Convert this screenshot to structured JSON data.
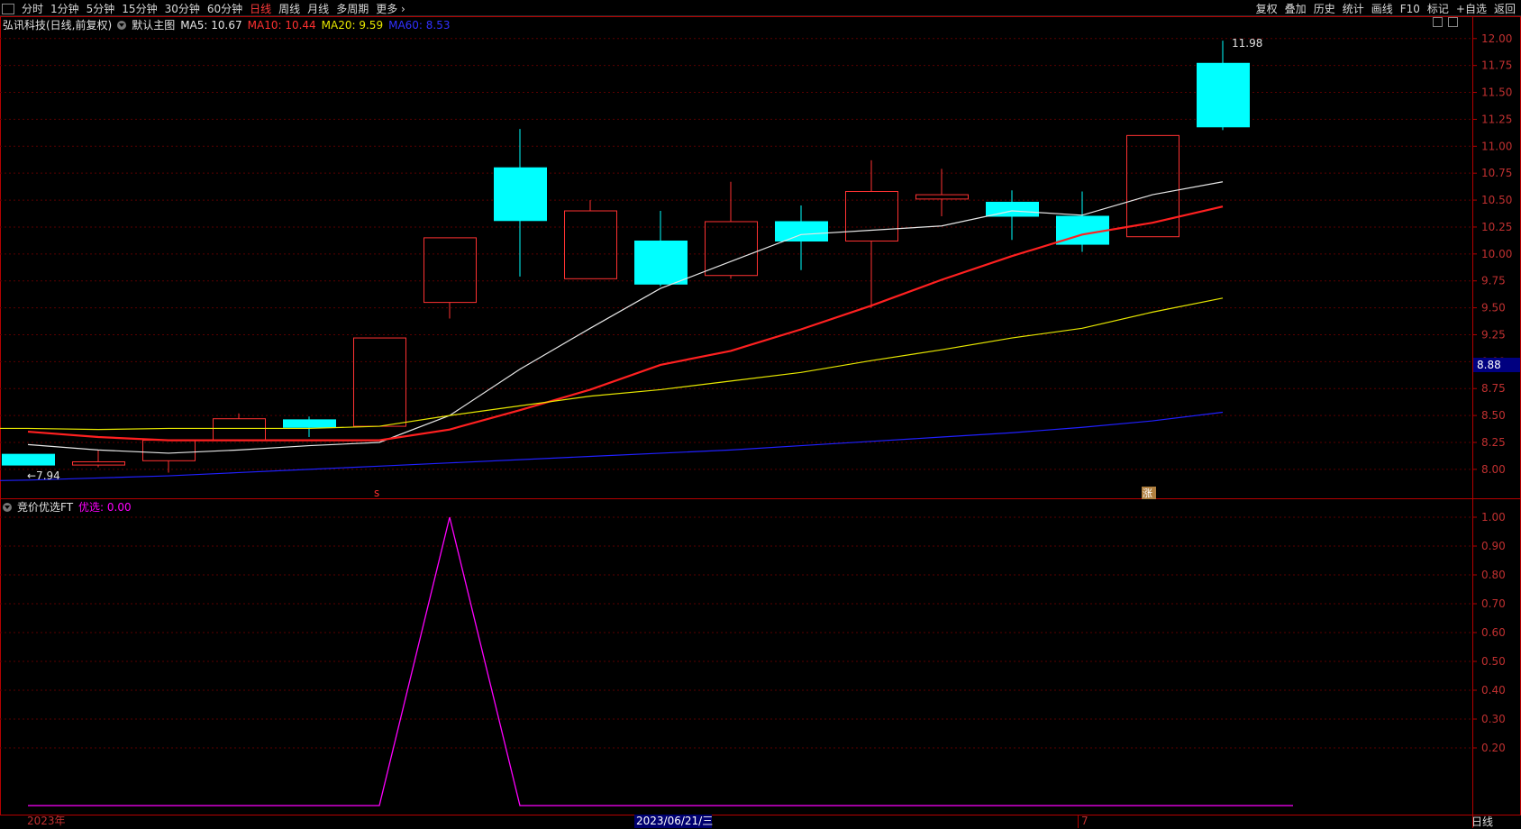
{
  "toolbar": {
    "left_items": [
      "分时",
      "1分钟",
      "5分钟",
      "15分钟",
      "30分钟",
      "60分钟",
      "日线",
      "周线",
      "月线",
      "多周期",
      "更多 ›"
    ],
    "active_item": "日线",
    "right_items": [
      "复权",
      "叠加",
      "历史",
      "统计",
      "画线",
      "F10",
      "标记",
      "+自选",
      "返回"
    ]
  },
  "legend_main": {
    "stock": "弘讯科技(日线,前复权)",
    "template": "默认主图",
    "ma5_label": "MA5: 10.67",
    "ma10_label": "MA10: 10.44",
    "ma20_label": "MA20: 9.59",
    "ma60_label": "MA60: 8.53"
  },
  "legend_sub": {
    "indicator": "竞价优选FT",
    "value_label": "优选: 0.00"
  },
  "colors": {
    "up": "#ff3232",
    "down": "#00ffff",
    "ma5": "#e6e6e6",
    "ma10": "#ff2020",
    "ma20": "#e6e600",
    "ma60": "#2020ff",
    "ft": "#ff00ff",
    "axis": "#b40000",
    "grid": "#5a0000"
  },
  "chart_data": [
    {
      "type": "candlestick",
      "ylim": [
        7.84,
        12.04
      ],
      "y_ticks": [
        8.0,
        8.25,
        8.5,
        8.75,
        9.0,
        9.25,
        9.5,
        9.75,
        10.0,
        10.25,
        10.5,
        10.75,
        11.0,
        11.25,
        11.5,
        11.75,
        12.0
      ],
      "candles": [
        {
          "open": 8.14,
          "high": 8.14,
          "low": 8.04,
          "close": 8.04
        },
        {
          "open": 8.04,
          "high": 8.18,
          "low": 8.02,
          "close": 8.07
        },
        {
          "open": 8.08,
          "high": 8.27,
          "low": 7.97,
          "close": 8.27
        },
        {
          "open": 8.27,
          "high": 8.52,
          "low": 8.26,
          "close": 8.47
        },
        {
          "open": 8.46,
          "high": 8.49,
          "low": 8.3,
          "close": 8.39
        },
        {
          "open": 8.4,
          "high": 9.22,
          "low": 8.4,
          "close": 9.22
        },
        {
          "open": 9.55,
          "high": 10.15,
          "low": 9.4,
          "close": 10.15
        },
        {
          "open": 10.8,
          "high": 11.16,
          "low": 9.79,
          "close": 10.31
        },
        {
          "open": 9.77,
          "high": 10.5,
          "low": 9.77,
          "close": 10.4
        },
        {
          "open": 10.12,
          "high": 10.4,
          "low": 9.7,
          "close": 9.72
        },
        {
          "open": 9.8,
          "high": 10.67,
          "low": 9.77,
          "close": 10.3
        },
        {
          "open": 10.3,
          "high": 10.45,
          "low": 9.85,
          "close": 10.12
        },
        {
          "open": 10.12,
          "high": 10.87,
          "low": 9.5,
          "close": 10.58
        },
        {
          "open": 10.51,
          "high": 10.79,
          "low": 10.35,
          "close": 10.55
        },
        {
          "open": 10.48,
          "high": 10.59,
          "low": 10.13,
          "close": 10.35
        },
        {
          "open": 10.35,
          "high": 10.58,
          "low": 10.02,
          "close": 10.09
        },
        {
          "open": 10.16,
          "high": 11.1,
          "low": 10.16,
          "close": 11.1
        },
        {
          "open": 11.77,
          "high": 11.98,
          "low": 11.15,
          "close": 11.18
        }
      ],
      "series": [
        {
          "name": "MA5",
          "values": [
            8.23,
            8.18,
            8.15,
            8.18,
            8.22,
            8.25,
            8.5,
            8.93,
            9.31,
            9.68,
            9.93,
            10.18,
            10.22,
            10.26,
            10.4,
            10.36,
            10.55,
            10.67
          ]
        },
        {
          "name": "MA10",
          "values": [
            8.35,
            8.3,
            8.27,
            8.27,
            8.27,
            8.27,
            8.37,
            8.55,
            8.74,
            8.97,
            9.1,
            9.3,
            9.52,
            9.76,
            9.98,
            10.18,
            10.29,
            10.44
          ]
        },
        {
          "name": "MA20",
          "values": [
            8.38,
            8.38,
            8.37,
            8.38,
            8.38,
            8.38,
            8.4,
            8.5,
            8.59,
            8.68,
            8.74,
            8.82,
            8.9,
            9.01,
            9.11,
            9.22,
            9.31,
            9.46,
            9.59
          ]
        },
        {
          "name": "MA60",
          "values": [
            7.89,
            7.9,
            7.92,
            7.94,
            7.97,
            8.0,
            8.03,
            8.06,
            8.09,
            8.12,
            8.15,
            8.18,
            8.22,
            8.26,
            8.3,
            8.34,
            8.39,
            8.45,
            8.53
          ]
        }
      ],
      "annotations": {
        "high_label": "11.98",
        "low_label": "←7.94",
        "right_price": "8.88",
        "marker_s": "s",
        "marker_2": "涨"
      }
    },
    {
      "type": "line",
      "ylim": [
        0,
        1.0
      ],
      "y_ticks": [
        "1.00",
        "0.90",
        "0.80",
        "0.70",
        "0.60",
        "0.50",
        "0.40",
        "0.30",
        "0.20"
      ],
      "series": [
        {
          "name": "优选",
          "values": [
            0,
            0,
            0,
            0,
            0,
            0,
            1,
            0,
            0,
            0,
            0,
            0,
            0,
            0,
            0,
            0,
            0,
            0,
            0
          ]
        }
      ]
    }
  ],
  "x_axis": {
    "left_label": "2023年",
    "mid_label": "2023/06/21/三",
    "right_label": "7",
    "period_tag": "日线"
  }
}
